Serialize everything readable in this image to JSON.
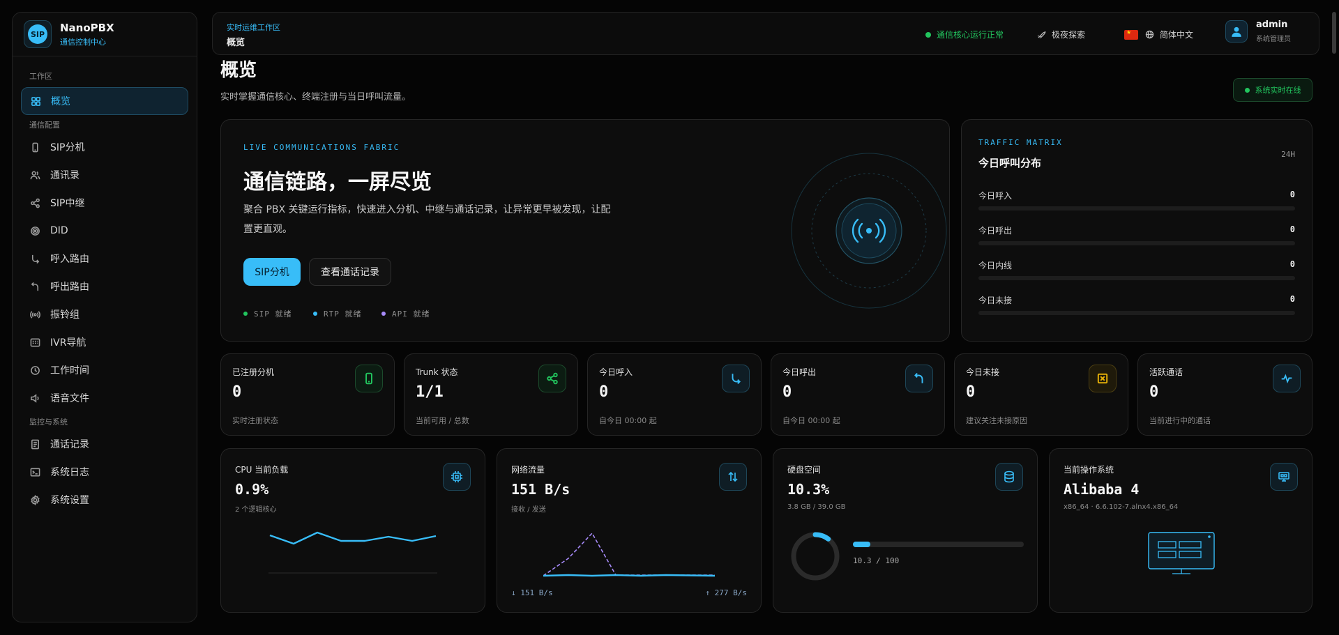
{
  "brand": {
    "logo_text": "SIP",
    "name": "NanoPBX",
    "subtitle": "通信控制中心"
  },
  "sidebar": {
    "group_workspace": "工作区",
    "group_comm": "通信配置",
    "group_monitor": "监控与系统",
    "items": [
      {
        "label": "概览",
        "icon": "grid-icon"
      },
      {
        "label": "SIP分机",
        "icon": "phone-icon"
      },
      {
        "label": "通讯录",
        "icon": "contacts-icon"
      },
      {
        "label": "SIP中继",
        "icon": "share-icon"
      },
      {
        "label": "DID",
        "icon": "target-icon"
      },
      {
        "label": "呼入路由",
        "icon": "incoming-call-icon"
      },
      {
        "label": "呼出路由",
        "icon": "outgoing-call-icon"
      },
      {
        "label": "振铃组",
        "icon": "ring-group-icon"
      },
      {
        "label": "IVR导航",
        "icon": "ivr-icon"
      },
      {
        "label": "工作时间",
        "icon": "clock-icon"
      },
      {
        "label": "语音文件",
        "icon": "speaker-icon"
      },
      {
        "label": "通话记录",
        "icon": "file-list-icon"
      },
      {
        "label": "系统日志",
        "icon": "terminal-icon"
      },
      {
        "label": "系统设置",
        "icon": "gear-icon"
      }
    ]
  },
  "topbar": {
    "crumb_top": "实时运维工作区",
    "crumb_main": "概览",
    "status": "通信核心运行正常",
    "theme": "极夜探索",
    "language": "简体中文",
    "user_name": "admin",
    "user_role": "系统管理员"
  },
  "page": {
    "title": "概览",
    "subtitle": "实时掌握通信核心、终端注册与当日呼叫流量。",
    "online_badge": "系统实时在线"
  },
  "hero": {
    "kicker": "LIVE COMMUNICATIONS FABRIC",
    "title": "通信链路，一屏尽览",
    "desc": "聚合 PBX 关键运行指标，快速进入分机、中继与通话记录，让异常更早被发现，让配置更直观。",
    "btn_primary": "SIP分机",
    "btn_secondary": "查看通话记录",
    "services": [
      {
        "label": "SIP 就绪",
        "color": "#22c55e"
      },
      {
        "label": "RTP 就绪",
        "color": "#38bdf8"
      },
      {
        "label": "API 就绪",
        "color": "#a78bfa"
      }
    ]
  },
  "traffic": {
    "kicker": "TRAFFIC MATRIX",
    "title": "今日呼叫分布",
    "range": "24H",
    "rows": [
      {
        "label": "今日呼入",
        "value": "0"
      },
      {
        "label": "今日呼出",
        "value": "0"
      },
      {
        "label": "今日内线",
        "value": "0"
      },
      {
        "label": "今日未接",
        "value": "0"
      }
    ]
  },
  "stats": [
    {
      "label": "已注册分机",
      "value": "0",
      "sub": "实时注册状态",
      "icon": "phone-icon",
      "color": "#22c55e"
    },
    {
      "label": "Trunk 状态",
      "value": "1/1",
      "sub": "当前可用 / 总数",
      "icon": "share-icon",
      "color": "#22c55e"
    },
    {
      "label": "今日呼入",
      "value": "0",
      "sub": "自今日 00:00 起",
      "icon": "incoming-call-icon",
      "color": "#38bdf8"
    },
    {
      "label": "今日呼出",
      "value": "0",
      "sub": "自今日 00:00 起",
      "icon": "outgoing-call-icon",
      "color": "#38bdf8"
    },
    {
      "label": "今日未接",
      "value": "0",
      "sub": "建议关注未接原因",
      "icon": "missed-call-icon",
      "color": "#eab308"
    },
    {
      "label": "活跃通话",
      "value": "0",
      "sub": "当前进行中的通话",
      "icon": "pulse-icon",
      "color": "#38bdf8"
    }
  ],
  "metrics": {
    "cpu": {
      "label": "CPU 当前负载",
      "value": "0.9%",
      "sub": "2 个逻辑核心",
      "icon": "cpu-icon"
    },
    "network": {
      "label": "网络流量",
      "value": "151 B/s",
      "sub": "接收 / 发送",
      "rx": "↓ 151 B/s",
      "tx": "↑ 277 B/s",
      "icon": "transfer-icon"
    },
    "disk": {
      "label": "硬盘空间",
      "value": "10.3%",
      "sub": "3.8 GB / 39.0 GB",
      "usage_text": "10.3 / 100",
      "percent": 10.3,
      "icon": "database-icon"
    },
    "os": {
      "label": "当前操作系统",
      "value": "Alibaba 4",
      "sub": "x86_64 · 6.6.102-7.alnx4.x86_64",
      "icon": "monitor-icon"
    }
  }
}
